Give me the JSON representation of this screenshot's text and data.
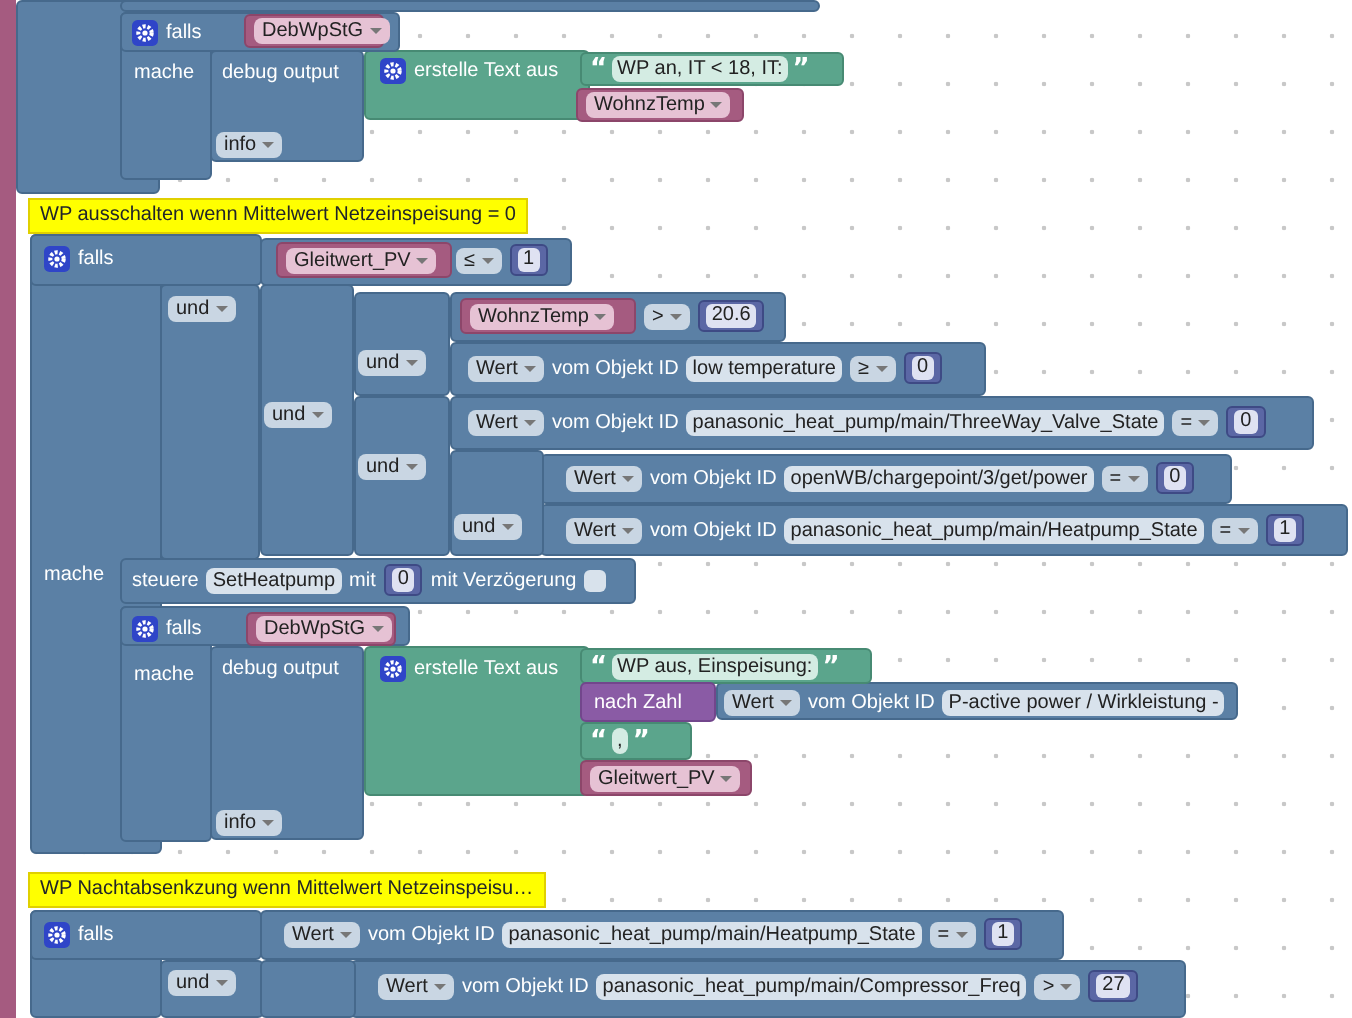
{
  "blocks": [
    {
      "kind": "event"
    },
    {
      "kind": "logic"
    },
    {
      "kind": "logic"
    },
    {
      "kind": "logic",
      "parts": [
        {
          "kind": "gear"
        },
        {
          "kind": "label",
          "text": "falls"
        },
        {
          "kind": "label",
          "text": "mache"
        }
      ]
    },
    {
      "kind": "variable",
      "parts": [
        {
          "kind": "dropdown",
          "text": "DebWpStG"
        }
      ]
    },
    {
      "kind": "logic",
      "parts": [
        {
          "kind": "label",
          "text": "debug output"
        },
        {
          "kind": "dropdown",
          "text": "info"
        }
      ]
    },
    {
      "kind": "text",
      "parts": [
        {
          "kind": "gear"
        },
        {
          "kind": "label",
          "text": "erstelle Text aus"
        }
      ]
    },
    {
      "kind": "text",
      "parts": [
        {
          "kind": "label",
          "text": "“"
        },
        {
          "kind": "field",
          "text": "WP an,  IT < 18, IT:"
        },
        {
          "kind": "label",
          "text": "”"
        }
      ]
    },
    {
      "kind": "variable",
      "parts": [
        {
          "kind": "dropdown",
          "text": "WohnzTemp"
        }
      ]
    },
    {
      "kind": "comment",
      "parts": [
        {
          "kind": "label",
          "text": "WP ausschalten wenn Mittelwert Netzeinspeisung = 0"
        }
      ]
    },
    {
      "kind": "logic",
      "parts": [
        {
          "kind": "gear"
        },
        {
          "kind": "label",
          "text": "falls"
        },
        {
          "kind": "label",
          "text": "mache"
        }
      ]
    },
    {
      "kind": "variable",
      "parts": [
        {
          "kind": "dropdown",
          "text": "Gleitwert_PV"
        }
      ]
    },
    {
      "kind": "logic",
      "parts": [
        {
          "kind": "dropdown",
          "text": "≤"
        },
        {
          "kind": "number",
          "text": "1"
        }
      ]
    },
    {
      "kind": "logic",
      "parts": [
        {
          "kind": "dropdown",
          "text": "und"
        }
      ]
    },
    {
      "kind": "logic",
      "parts": [
        {
          "kind": "dropdown",
          "text": "und"
        }
      ]
    },
    {
      "kind": "logic",
      "parts": [
        {
          "kind": "dropdown",
          "text": "und"
        }
      ]
    },
    {
      "kind": "variable",
      "parts": [
        {
          "kind": "dropdown",
          "text": "WohnzTemp"
        }
      ]
    },
    {
      "kind": "logic",
      "parts": [
        {
          "kind": "dropdown",
          "text": ">"
        },
        {
          "kind": "number",
          "text": "20.6"
        }
      ]
    },
    {
      "kind": "logic",
      "parts": [
        {
          "kind": "dropdown",
          "text": "Wert"
        },
        {
          "kind": "label",
          "text": "vom Objekt ID"
        },
        {
          "kind": "field",
          "text": "low temperature"
        },
        {
          "kind": "dropdown",
          "text": "≥"
        },
        {
          "kind": "number",
          "text": "0"
        }
      ]
    },
    {
      "kind": "logic",
      "parts": [
        {
          "kind": "dropdown",
          "text": "und"
        }
      ]
    },
    {
      "kind": "logic",
      "parts": [
        {
          "kind": "dropdown",
          "text": "Wert"
        },
        {
          "kind": "label",
          "text": "vom Objekt ID"
        },
        {
          "kind": "field",
          "text": "panasonic_heat_pump/main/ThreeWay_Valve_State"
        },
        {
          "kind": "dropdown",
          "text": "="
        },
        {
          "kind": "number",
          "text": "0"
        }
      ]
    },
    {
      "kind": "logic",
      "parts": [
        {
          "kind": "dropdown",
          "text": "und"
        }
      ]
    },
    {
      "kind": "logic",
      "parts": [
        {
          "kind": "dropdown",
          "text": "Wert"
        },
        {
          "kind": "label",
          "text": "vom Objekt ID"
        },
        {
          "kind": "field",
          "text": "openWB/chargepoint/3/get/power"
        },
        {
          "kind": "dropdown",
          "text": "="
        },
        {
          "kind": "number",
          "text": "0"
        }
      ]
    },
    {
      "kind": "logic",
      "parts": [
        {
          "kind": "dropdown",
          "text": "Wert"
        },
        {
          "kind": "label",
          "text": "vom Objekt ID"
        },
        {
          "kind": "field",
          "text": "panasonic_heat_pump/main/Heatpump_State"
        },
        {
          "kind": "dropdown",
          "text": "="
        },
        {
          "kind": "number",
          "text": "1"
        }
      ]
    },
    {
      "kind": "logic",
      "parts": [
        {
          "kind": "label",
          "text": "steuere"
        },
        {
          "kind": "field",
          "text": "SetHeatpump"
        },
        {
          "kind": "label",
          "text": "mit"
        },
        {
          "kind": "number",
          "text": "0"
        },
        {
          "kind": "label",
          "text": "mit Verzögerung"
        },
        {
          "kind": "checkbox",
          "checked": false
        }
      ]
    },
    {
      "kind": "logic",
      "parts": [
        {
          "kind": "gear"
        },
        {
          "kind": "label",
          "text": "falls"
        },
        {
          "kind": "label",
          "text": "mache"
        }
      ]
    },
    {
      "kind": "variable",
      "parts": [
        {
          "kind": "dropdown",
          "text": "DebWpStG"
        }
      ]
    },
    {
      "kind": "logic",
      "parts": [
        {
          "kind": "label",
          "text": "debug output"
        },
        {
          "kind": "dropdown",
          "text": "info"
        }
      ]
    },
    {
      "kind": "text",
      "parts": [
        {
          "kind": "gear"
        },
        {
          "kind": "label",
          "text": "erstelle Text aus"
        }
      ]
    },
    {
      "kind": "text",
      "parts": [
        {
          "kind": "label",
          "text": "“"
        },
        {
          "kind": "field",
          "text": "WP aus, Einspeisung:"
        },
        {
          "kind": "label",
          "text": "”"
        }
      ]
    },
    {
      "kind": "math",
      "parts": [
        {
          "kind": "label",
          "text": "nach Zahl"
        }
      ]
    },
    {
      "kind": "logic",
      "parts": [
        {
          "kind": "dropdown",
          "text": "Wert"
        },
        {
          "kind": "label",
          "text": "vom Objekt ID"
        },
        {
          "kind": "field",
          "text": "P-active power / Wirkleistung -"
        }
      ]
    },
    {
      "kind": "text",
      "parts": [
        {
          "kind": "label",
          "text": "“"
        },
        {
          "kind": "field",
          "text": ","
        },
        {
          "kind": "label",
          "text": "”"
        }
      ]
    },
    {
      "kind": "variable",
      "parts": [
        {
          "kind": "dropdown",
          "text": "Gleitwert_PV"
        }
      ]
    },
    {
      "kind": "comment",
      "parts": [
        {
          "kind": "label",
          "text": "WP Nachtabsenkzung wenn Mittelwert Netzeinspeisu…"
        }
      ]
    },
    {
      "kind": "logic",
      "parts": [
        {
          "kind": "gear"
        },
        {
          "kind": "label",
          "text": "falls"
        }
      ]
    },
    {
      "kind": "logic",
      "parts": [
        {
          "kind": "dropdown",
          "text": "und"
        }
      ]
    },
    {
      "kind": "logic",
      "parts": [
        {
          "kind": "dropdown",
          "text": "Wert"
        },
        {
          "kind": "label",
          "text": "vom Objekt ID"
        },
        {
          "kind": "field",
          "text": "panasonic_heat_pump/main/Heatpump_State"
        },
        {
          "kind": "dropdown",
          "text": "="
        },
        {
          "kind": "number",
          "text": "1"
        }
      ]
    },
    {
      "kind": "logic"
    },
    {
      "kind": "logic",
      "parts": [
        {
          "kind": "dropdown",
          "text": "Wert"
        },
        {
          "kind": "label",
          "text": "vom Objekt ID"
        },
        {
          "kind": "field",
          "text": "panasonic_heat_pump/main/Compressor_Freq"
        },
        {
          "kind": "dropdown",
          "text": ">"
        },
        {
          "kind": "number",
          "text": "27"
        }
      ]
    }
  ]
}
